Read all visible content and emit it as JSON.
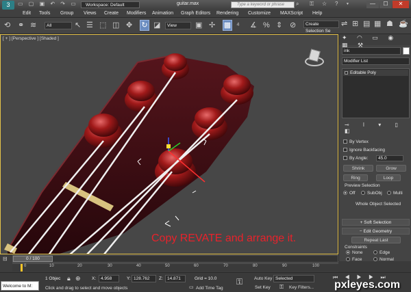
{
  "title_bar": {
    "workspace": "Workspace: Default",
    "filename": "guitar.max",
    "search_placeholder": "Type a keyword or phrase"
  },
  "menu": [
    "Edit",
    "Tools",
    "Group",
    "Views",
    "Create",
    "Modifiers",
    "Animation",
    "Graph Editors",
    "Rendering",
    "Customize",
    "MAXScript",
    "Help"
  ],
  "toolbar": {
    "filter_dropdown": "All",
    "coord_dropdown": "View",
    "selection_set": "Create Selection Se"
  },
  "viewport": {
    "label": "[ + ] [Perspective ] [Shaded ]",
    "overlay_text": "Copy REVATE and arrange it."
  },
  "command_panel": {
    "object_name": "ink",
    "modifier_list": "Modifier List",
    "stack_item": "Editable Poly",
    "by_vertex": "By Vertex",
    "ignore_backfacing": "Ignore Backfacing",
    "by_angle": "By Angle:",
    "by_angle_value": "45.0",
    "shrink": "Shrink",
    "grow": "Grow",
    "ring": "Ring",
    "loop": "Loop",
    "preview_selection": "Preview Selection",
    "preview_off": "Off",
    "preview_subobj": "SubObj",
    "preview_multi": "Multi",
    "whole_object": "Whole Object Selected",
    "soft_selection": "Soft Selection",
    "edit_geometry": "Edit Geometry",
    "repeat_last": "Repeat Last",
    "constraints": "Constraints",
    "c_none": "None",
    "c_edge": "Edge",
    "c_face": "Face",
    "c_normal": "Normal"
  },
  "timeline": {
    "slider": "0 / 100",
    "ticks": [
      "0",
      "10",
      "20",
      "30",
      "40",
      "50",
      "60",
      "70",
      "80",
      "90",
      "100"
    ]
  },
  "status": {
    "welcome": "Welcome to M:",
    "objects": "1 Objec",
    "x_label": "X:",
    "x_value": "4.958",
    "y_label": "Y:",
    "y_value": "128.762",
    "z_label": "Z:",
    "z_value": "14.871",
    "grid": "Grid = 10.0",
    "prompt": "Click and drag to select and move objects",
    "add_time_tag": "Add Time Tag",
    "auto_key": "Auto Key",
    "set_key": "Set Key",
    "selected": "Selected",
    "key_filters": "Key Filters..."
  },
  "watermark": "pxleyes.com"
}
